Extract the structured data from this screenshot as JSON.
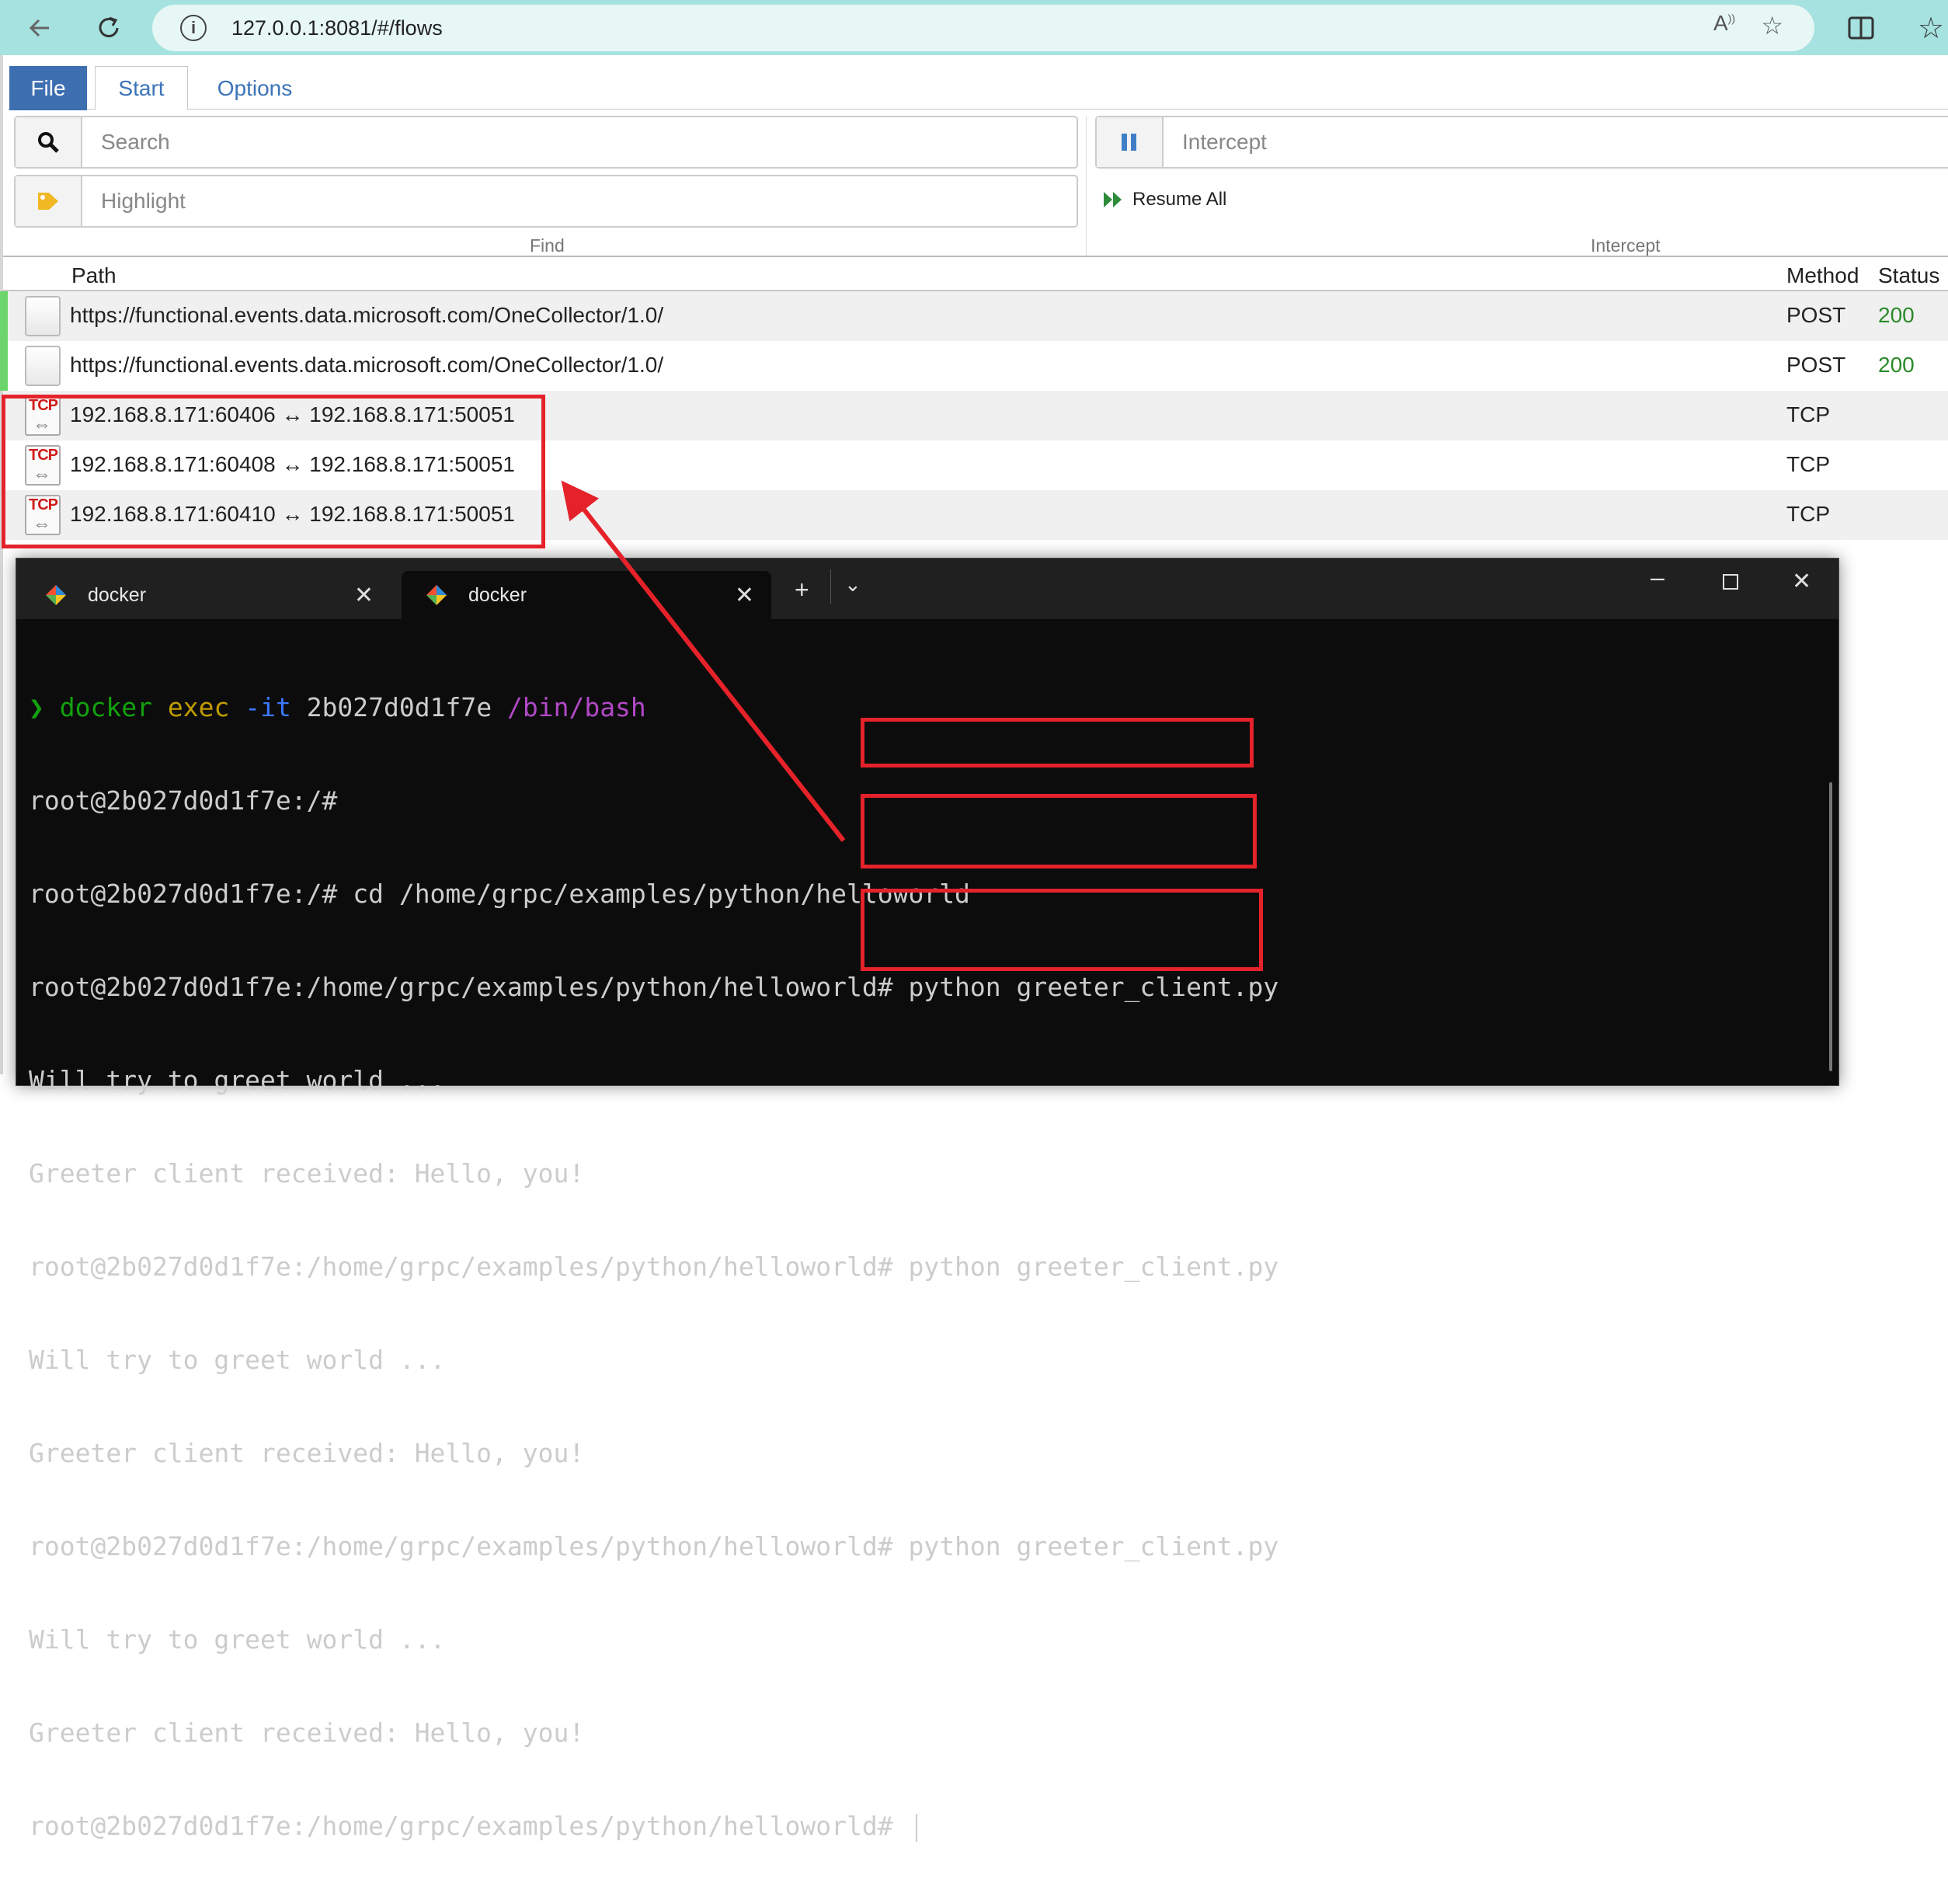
{
  "browser": {
    "url": "127.0.0.1:8081/#/flows"
  },
  "menu": {
    "tabs": [
      "File",
      "Start",
      "Options"
    ]
  },
  "find": {
    "search_placeholder": "Search",
    "highlight_placeholder": "Highlight",
    "group_label": "Find"
  },
  "intercept": {
    "placeholder": "Intercept",
    "resume_all": "Resume All",
    "group_label": "Intercept"
  },
  "table": {
    "columns": {
      "path": "Path",
      "method": "Method",
      "status": "Status"
    },
    "rows": [
      {
        "path": "https://functional.events.data.microsoft.com/OneCollector/1.0/",
        "method": "POST",
        "status": "200",
        "icon": "document-icon",
        "marker": "#6bd56b"
      },
      {
        "path": "https://functional.events.data.microsoft.com/OneCollector/1.0/",
        "method": "POST",
        "status": "200",
        "icon": "document-icon",
        "marker": "#6bd56b"
      },
      {
        "path": "192.168.8.171:60406 ↔ 192.168.8.171:50051",
        "method": "TCP",
        "status": "",
        "icon": "tcp-icon",
        "marker": ""
      },
      {
        "path": "192.168.8.171:60408 ↔ 192.168.8.171:50051",
        "method": "TCP",
        "status": "",
        "icon": "tcp-icon",
        "marker": ""
      },
      {
        "path": "192.168.8.171:60410 ↔ 192.168.8.171:50051",
        "method": "TCP",
        "status": "",
        "icon": "tcp-icon",
        "marker": ""
      }
    ]
  },
  "terminal": {
    "tabs": [
      "docker",
      "docker"
    ],
    "prompt_symbol": "❯",
    "cmd_docker": "docker",
    "cmd_exec": "exec",
    "cmd_flag": "-it",
    "cmd_container": "2b027d0d1f7e",
    "cmd_shell": "/bin/bash",
    "lines": [
      "root@2b027d0d1f7e:/#",
      "root@2b027d0d1f7e:/# cd /home/grpc/examples/python/helloworld",
      "root@2b027d0d1f7e:/home/grpc/examples/python/helloworld# python greeter_client.py",
      "Will try to greet world ...",
      "Greeter client received: Hello, you!",
      "root@2b027d0d1f7e:/home/grpc/examples/python/helloworld# python greeter_client.py",
      "Will try to greet world ...",
      "Greeter client received: Hello, you!",
      "root@2b027d0d1f7e:/home/grpc/examples/python/helloworld# python greeter_client.py",
      "Will try to greet world ...",
      "Greeter client received: Hello, you!",
      "root@2b027d0d1f7e:/home/grpc/examples/python/helloworld# "
    ]
  },
  "colors": {
    "annotation_red": "#e5222a",
    "status_ok": "#2a8a2a",
    "file_tab": "#3d6eb0",
    "browser_bar": "#a6e2e0"
  }
}
